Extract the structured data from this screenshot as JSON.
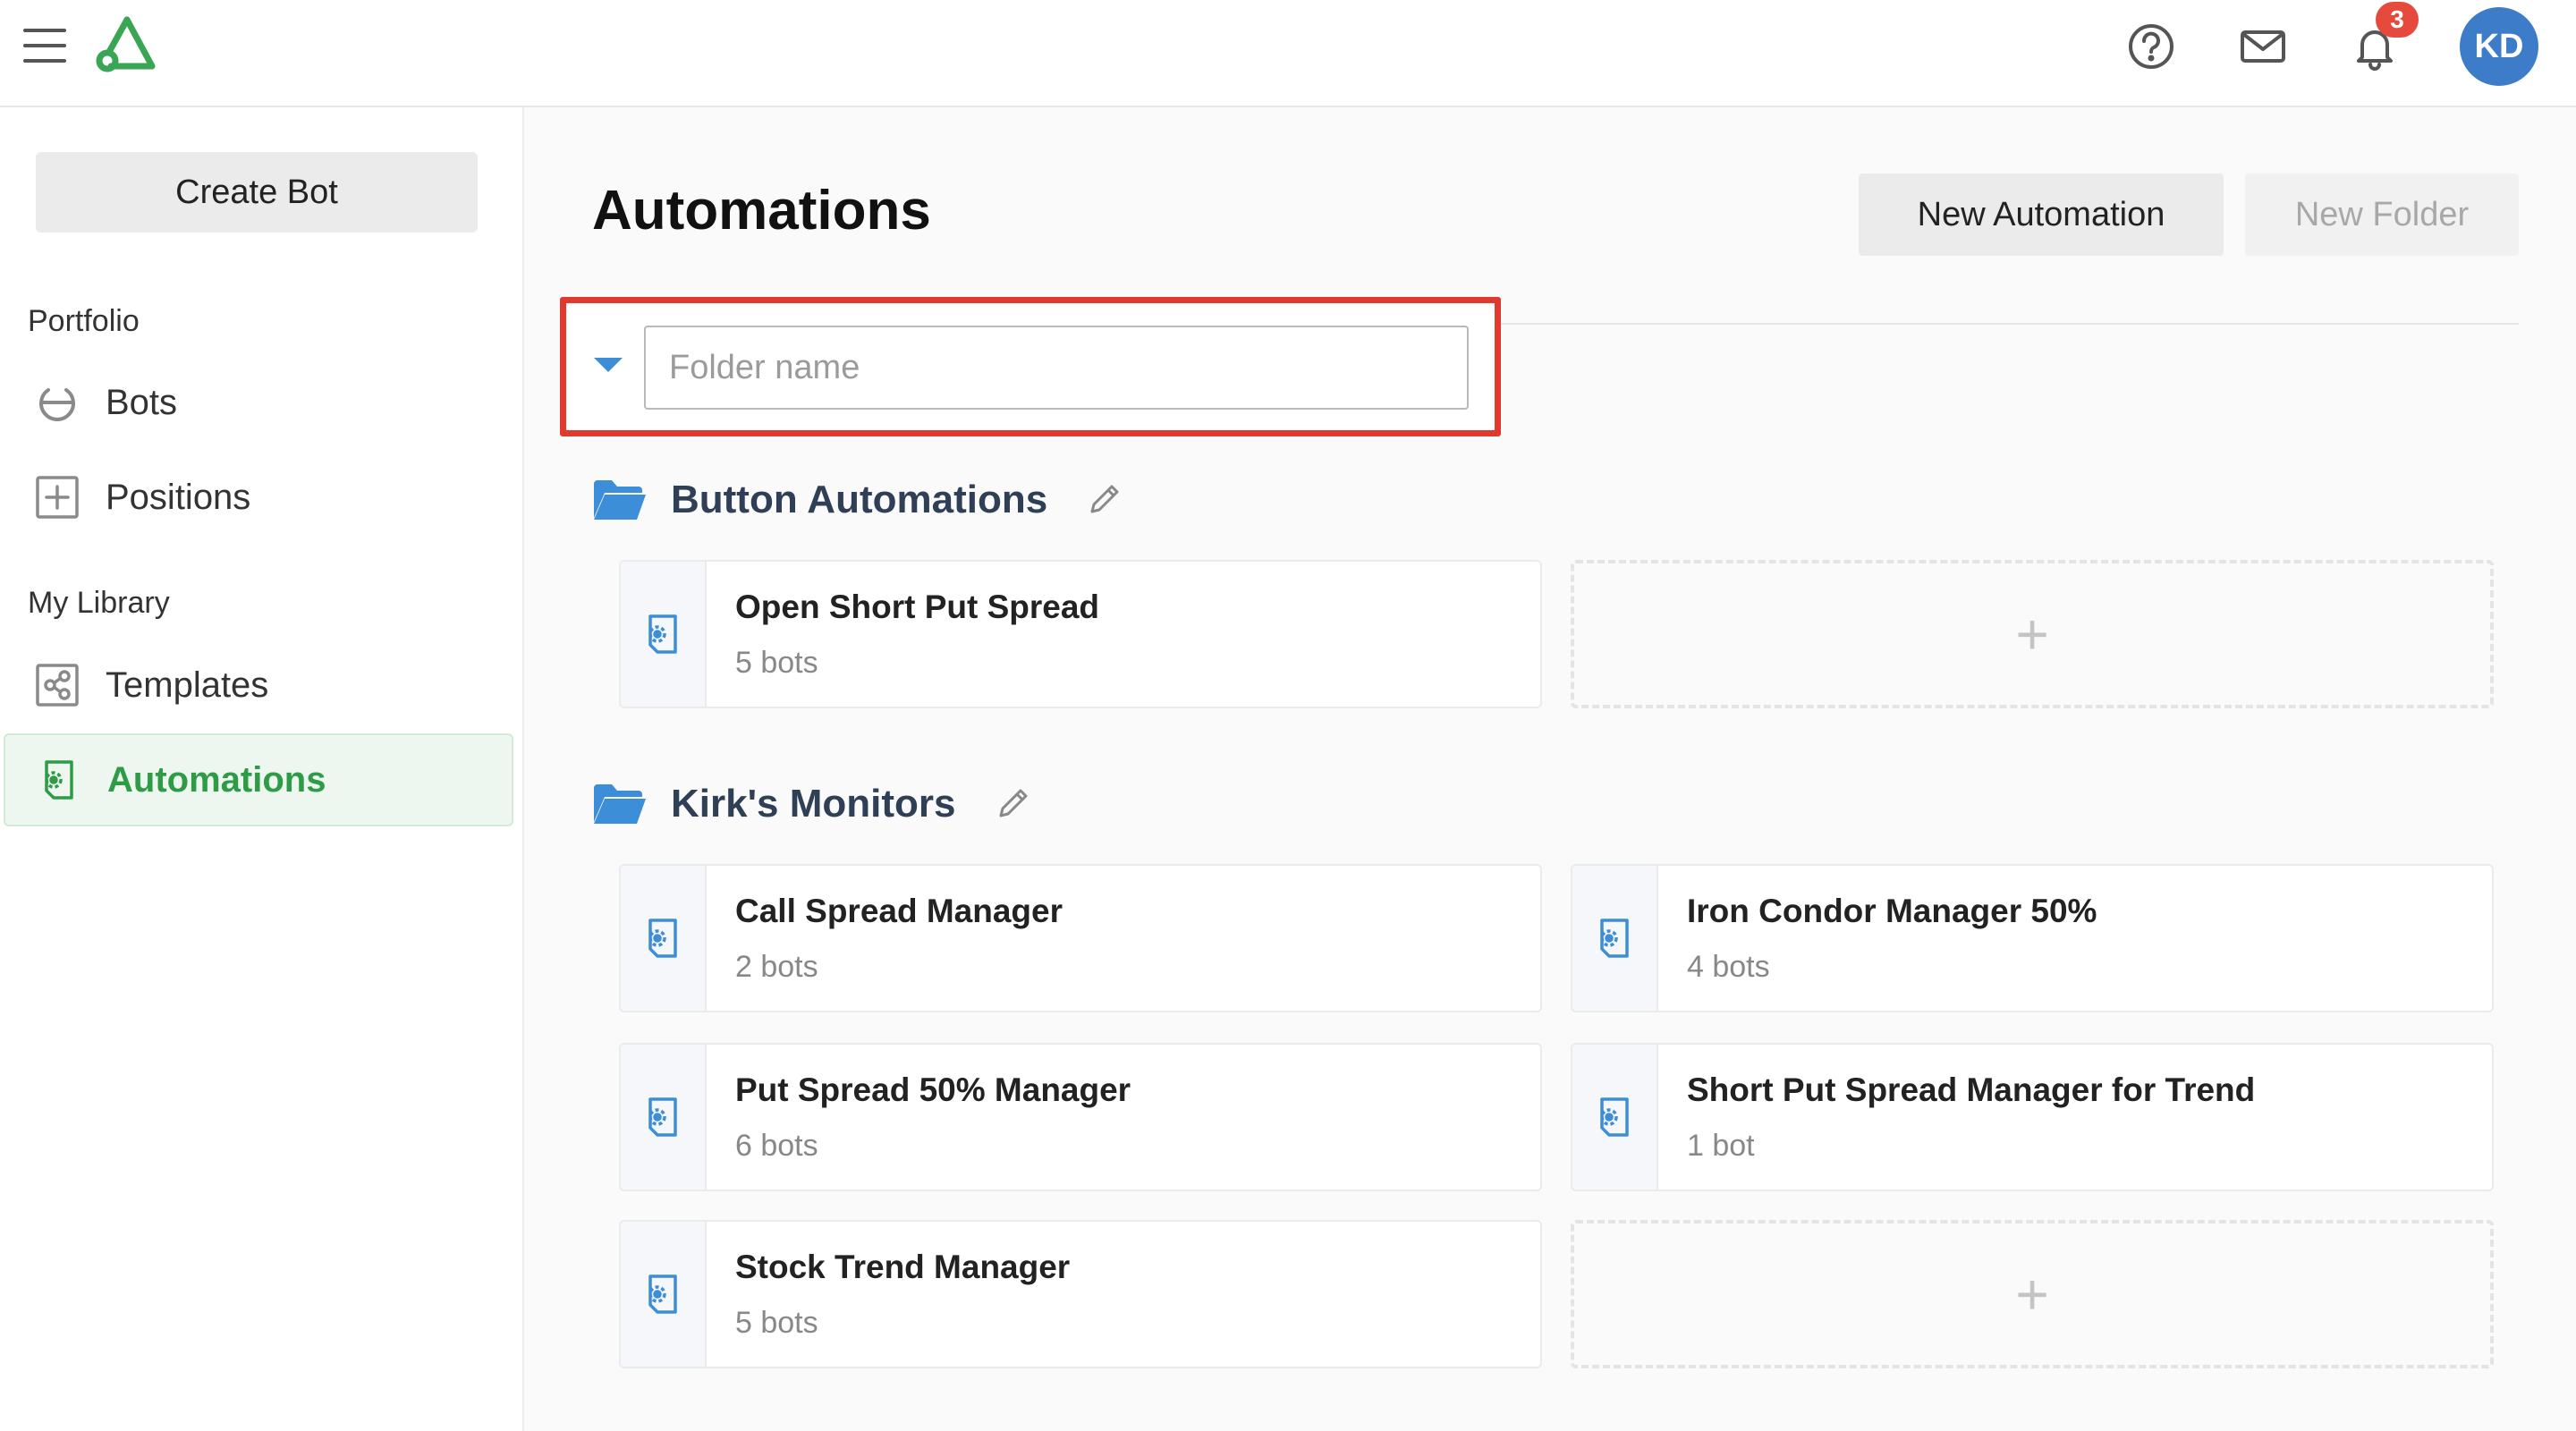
{
  "topbar": {
    "notification_count": "3",
    "avatar_initials": "KD"
  },
  "sidebar": {
    "create_bot_label": "Create Bot",
    "sections": [
      {
        "label": "Portfolio",
        "items": [
          {
            "label": "Bots",
            "icon": "power-icon"
          },
          {
            "label": "Positions",
            "icon": "plus-square-icon"
          }
        ]
      },
      {
        "label": "My Library",
        "items": [
          {
            "label": "Templates",
            "icon": "share-icon"
          },
          {
            "label": "Automations",
            "icon": "automation-icon",
            "active": true
          }
        ]
      }
    ]
  },
  "main": {
    "title": "Automations",
    "new_automation_label": "New Automation",
    "new_folder_label": "New Folder",
    "folder_input": {
      "value": "",
      "placeholder": "Folder name"
    },
    "folders": [
      {
        "name": "Button Automations",
        "automations": [
          {
            "title": "Open Short Put Spread",
            "count": "5 bots"
          }
        ],
        "add_label": "+"
      },
      {
        "name": "Kirk's Monitors",
        "automations": [
          {
            "title": "Call Spread Manager",
            "count": "2 bots"
          },
          {
            "title": "Iron Condor Manager 50%",
            "count": "4 bots"
          },
          {
            "title": "Put Spread 50% Manager",
            "count": "6 bots"
          },
          {
            "title": "Short Put Spread Manager for Trend",
            "count": "1 bot"
          },
          {
            "title": "Stock Trend Manager",
            "count": "5 bots"
          }
        ],
        "add_label": "+"
      }
    ]
  },
  "colors": {
    "accent_green": "#2e9b47",
    "accent_blue": "#3d8ed8",
    "highlight_red": "#e03a2f",
    "badge_red": "#e64a3c",
    "avatar_blue": "#3d7cc9"
  }
}
